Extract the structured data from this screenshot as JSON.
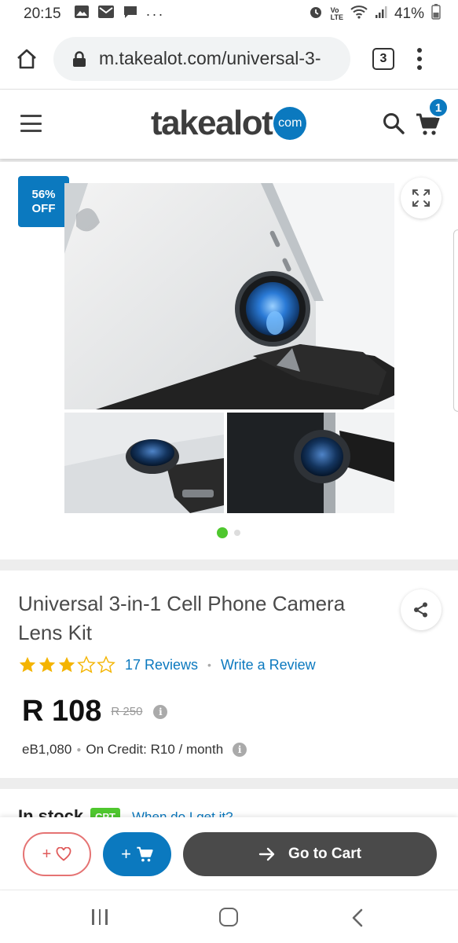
{
  "status_bar": {
    "time": "20:15",
    "battery": "41%"
  },
  "browser": {
    "url": "m.takealot.com/universal-3-",
    "tab_count": "3"
  },
  "header": {
    "logo_word": "takealot",
    "logo_badge": "com",
    "cart_count": "1"
  },
  "gallery": {
    "discount_line1": "56%",
    "discount_line2": "OFF",
    "active_slide": 1,
    "slide_count": 2
  },
  "product": {
    "title": "Universal 3-in-1 Cell Phone Camera Lens Kit",
    "rating": 3,
    "rating_max": 5,
    "reviews_label": "17 Reviews",
    "write_review_label": "Write a Review",
    "price": "R 108",
    "old_price": "R 250",
    "ebucks": "eB1,080",
    "credit": "On Credit: R10 / month"
  },
  "stock": {
    "label": "In stock",
    "badge": "CPT",
    "when_link": "When do I get it?"
  },
  "actions": {
    "wishlist_plus": "+",
    "add_plus": "+",
    "go_to_cart": "Go to Cart"
  },
  "colors": {
    "brand_blue": "#0b79bf",
    "green": "#4fc72e",
    "dark_button": "#4a4a4a",
    "star": "#f4b400",
    "wishlist_red": "#e57373"
  }
}
